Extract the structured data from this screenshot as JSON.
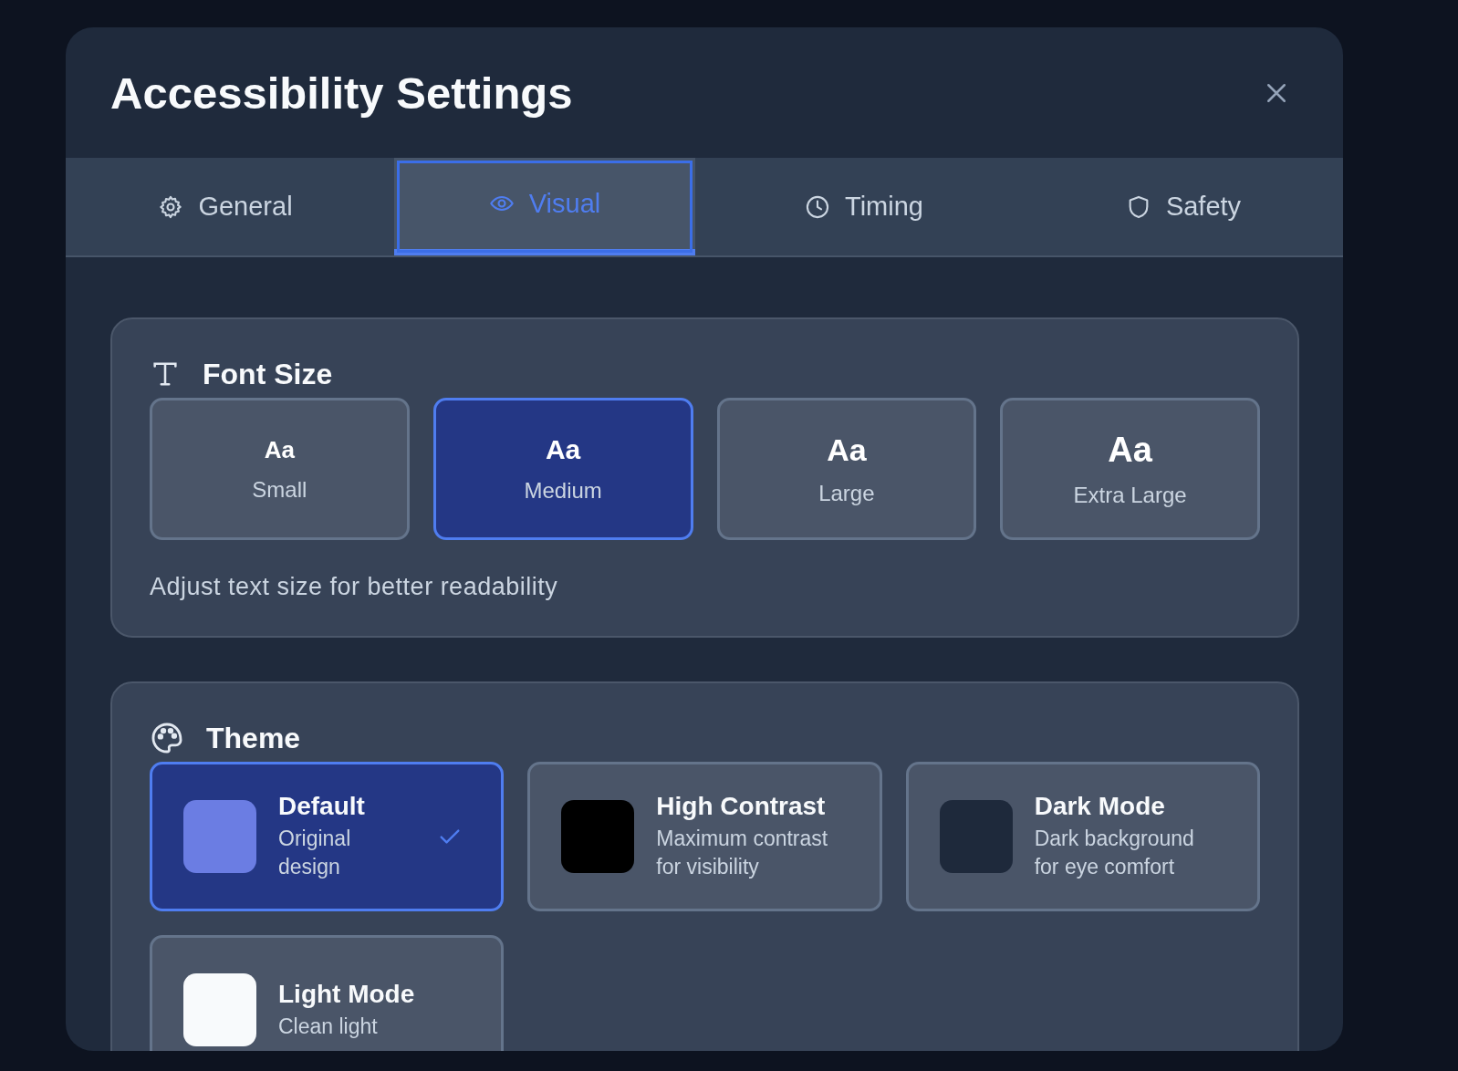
{
  "dialog": {
    "title": "Accessibility Settings"
  },
  "tabs": [
    {
      "label": "General",
      "kind": "gear",
      "selected": false
    },
    {
      "label": "Visual",
      "kind": "eye",
      "selected": true
    },
    {
      "label": "Timing",
      "kind": "clock",
      "selected": false
    },
    {
      "label": "Safety",
      "kind": "shield",
      "selected": false
    }
  ],
  "font_size": {
    "title": "Font Size",
    "description": "Adjust text size for better readability",
    "options": [
      {
        "sample": "Aa",
        "label": "Small",
        "selected": false
      },
      {
        "sample": "Aa",
        "label": "Medium",
        "selected": true
      },
      {
        "sample": "Aa",
        "label": "Large",
        "selected": false
      },
      {
        "sample": "Aa",
        "label": "Extra Large",
        "selected": false
      }
    ]
  },
  "theme": {
    "title": "Theme",
    "options": [
      {
        "name": "Default",
        "description": "Original design",
        "color": "#6b7de3",
        "selected": true
      },
      {
        "name": "High Contrast",
        "description": "Maximum contrast for visibility",
        "color": "#000000",
        "selected": false
      },
      {
        "name": "Dark Mode",
        "description": "Dark background for eye comfort",
        "color": "#1e293b",
        "selected": false
      },
      {
        "name": "Light Mode",
        "description": "Clean light",
        "color": "#f8fafc",
        "selected": false
      }
    ]
  }
}
